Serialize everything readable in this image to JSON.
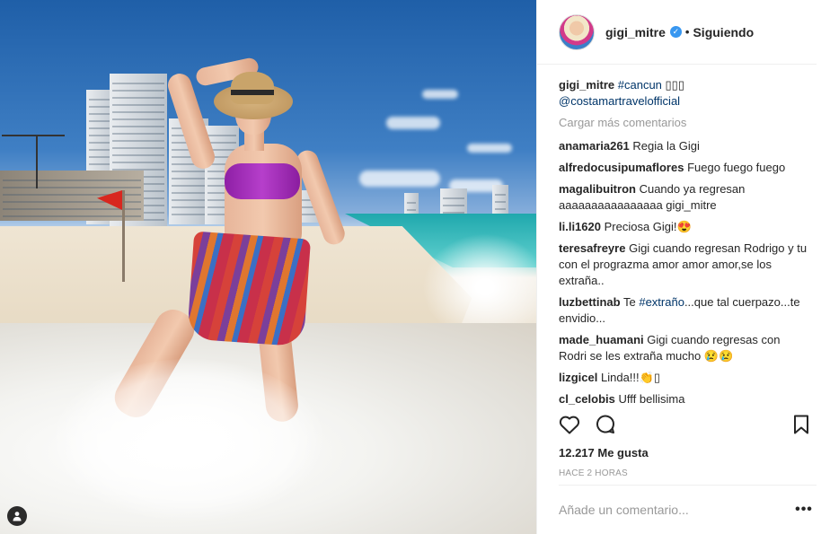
{
  "post": {
    "image_alt": "Beach photo",
    "header": {
      "username": "gigi_mitre",
      "verified_badge": "verified-check-icon",
      "separator": "•",
      "follow_status": "Siguiendo"
    },
    "caption": {
      "username": "gigi_mitre",
      "hashtag": "#cancun",
      "emojis": "▯▯▯",
      "mention": "@costamartravelofficial"
    },
    "load_more": "Cargar más comentarios",
    "comments": [
      {
        "user": "anamaria261",
        "text": "Regia la Gigi"
      },
      {
        "user": "alfredocusipumaflores",
        "text": "Fuego fuego fuego"
      },
      {
        "user": "magalibuitron",
        "text": "Cuando ya regresan aaaaaaaaaaaaaaaa gigi_mitre"
      },
      {
        "user": "li.li1620",
        "text": "Preciosa Gigi!😍"
      },
      {
        "user": "teresafreyre",
        "text": "Gigi cuando regresan Rodrigo y tu con el prograzma amor amor amor,se los extraña.."
      },
      {
        "user": "luzbettinab",
        "text_pre": "Te ",
        "hashtag": "#extraño",
        "text_post": "...que tal cuerpazo...te envidio..."
      },
      {
        "user": "made_huamani",
        "text": "Gigi cuando regresas con Rodri se les extraña mucho 😢😢"
      },
      {
        "user": "lizgicel",
        "text": "Linda!!!👏▯"
      },
      {
        "user": "cl_celobis",
        "text": "Ufff bellisima"
      }
    ],
    "likes": "12.217 Me gusta",
    "time": "HACE 2 HORAS",
    "comment_placeholder": "Añade un comentario...",
    "more_options": "•••",
    "icons": {
      "like": "heart-icon",
      "comment": "comment-bubble-icon",
      "save": "bookmark-icon",
      "tag": "user-tag-icon"
    },
    "colors": {
      "link": "#003569",
      "verified": "#3897f0",
      "muted": "#999999",
      "text": "#262626"
    }
  }
}
